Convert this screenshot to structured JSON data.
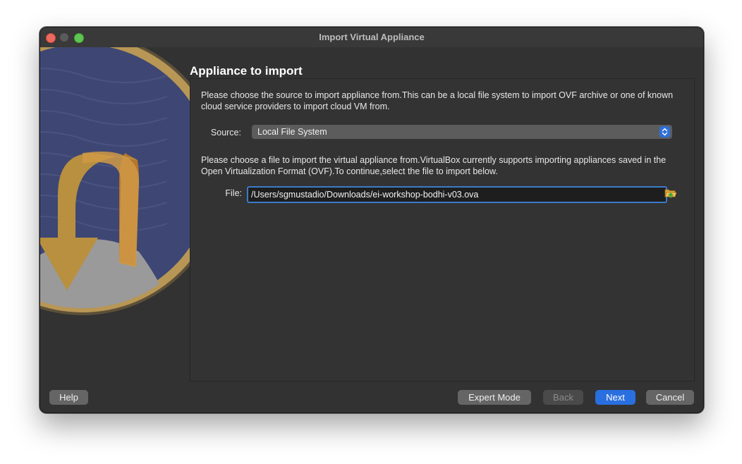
{
  "window": {
    "title": "Import Virtual Appliance"
  },
  "page": {
    "heading": "Appliance to import",
    "description_source": "Please choose the source to import appliance from.This can be a local file system to import OVF archive or one of known cloud service providers to import cloud VM from.",
    "description_file": "Please choose a file to import the virtual appliance from.VirtualBox currently supports importing appliances saved in the Open Virtualization Format (OVF).To continue,select the file to import below."
  },
  "source": {
    "label": "Source:",
    "selected": "Local File System"
  },
  "file": {
    "label": "File:",
    "value": "/Users/sgmustadio/Downloads/ei-workshop-bodhi-v03.ova"
  },
  "buttons": {
    "help": "Help",
    "expert_mode": "Expert Mode",
    "back": "Back",
    "next": "Next",
    "cancel": "Cancel"
  },
  "icons": {
    "chooser": "folder-open-icon",
    "select_arrows": "updown-chevron-icon",
    "watermark": "import-appliance-logo"
  },
  "colors": {
    "accent": "#2a6fe0",
    "window_bg": "#323232",
    "focus_ring": "#3b7bc8"
  }
}
